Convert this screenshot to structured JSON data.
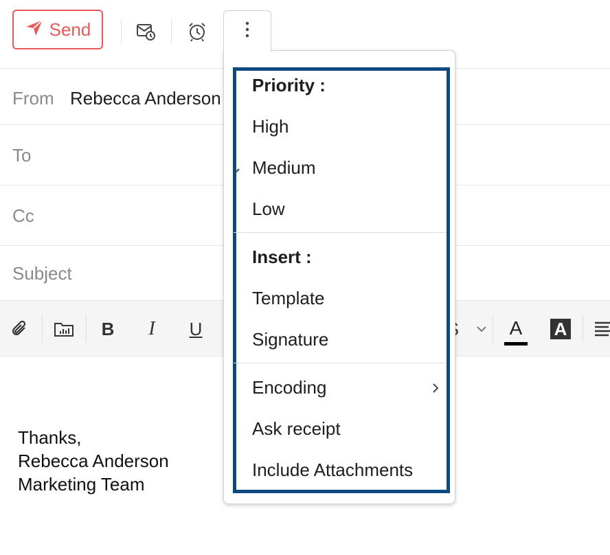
{
  "toolbar": {
    "send_label": "Send",
    "icons": [
      "send-icon",
      "schedule-icon",
      "reminder-icon",
      "more-options-icon"
    ]
  },
  "fields": {
    "from_label": "From",
    "from_value": "Rebecca Anderson",
    "to_label": "To",
    "cc_label": "Cc",
    "subject_label": "Subject"
  },
  "format_bar": {
    "bold": "B",
    "italic": "I",
    "underline": "U",
    "font_color": "A",
    "highlight": "A",
    "partial_glyph": "S"
  },
  "body": {
    "lines": [
      "Thanks,",
      "Rebecca Anderson",
      "Marketing Team"
    ]
  },
  "menu": {
    "priority_heading": "Priority :",
    "priority_items": [
      "High",
      "Medium",
      "Low"
    ],
    "selected_priority": "Medium",
    "insert_heading": "Insert :",
    "insert_items": [
      "Template",
      "Signature"
    ],
    "other_items": [
      "Encoding",
      "Ask receipt",
      "Include Attachments"
    ]
  },
  "colors": {
    "send_accent": "#e55a5a",
    "highlight_border": "#0b4a7e"
  }
}
